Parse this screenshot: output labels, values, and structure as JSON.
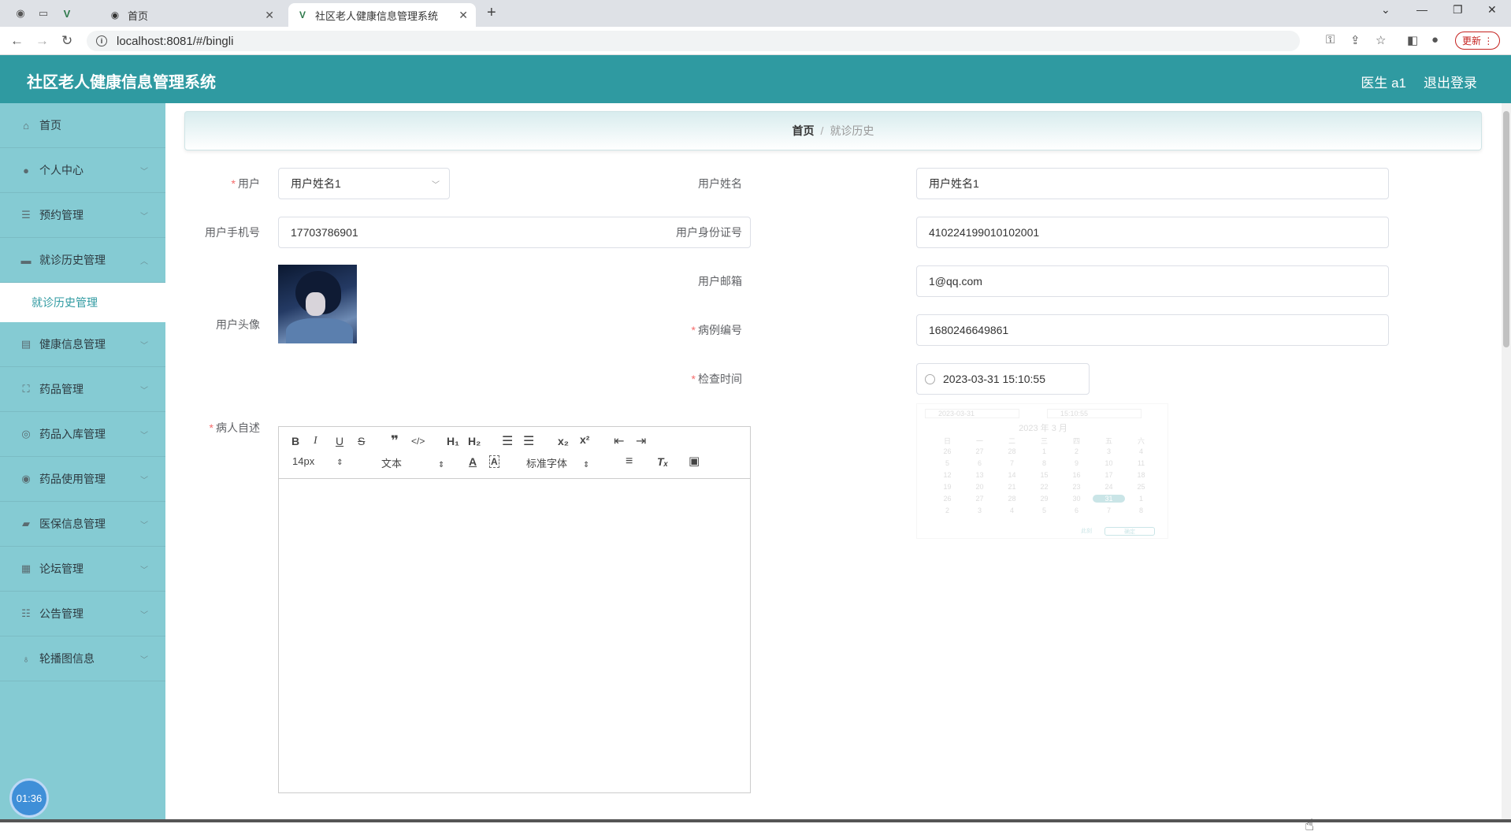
{
  "browser": {
    "tabs": [
      {
        "title": "首页",
        "active": false
      },
      {
        "title": "社区老人健康信息管理系统",
        "active": true
      }
    ],
    "url": "localhost:8081/#/bingli",
    "update_label": "更新"
  },
  "header": {
    "title": "社区老人健康信息管理系统",
    "user": "医生 a1",
    "logout": "退出登录"
  },
  "sidebar": {
    "items": [
      {
        "label": "首页",
        "icon": "home-icon"
      },
      {
        "label": "个人中心",
        "icon": "user-icon"
      },
      {
        "label": "预约管理",
        "icon": "list-icon"
      },
      {
        "label": "就诊历史管理",
        "icon": "folder-icon",
        "expanded": true
      },
      {
        "label": "健康信息管理",
        "icon": "clipboard-icon"
      },
      {
        "label": "药品管理",
        "icon": "frame-icon"
      },
      {
        "label": "药品入库管理",
        "icon": "compass-icon"
      },
      {
        "label": "药品使用管理",
        "icon": "target-icon"
      },
      {
        "label": "医保信息管理",
        "icon": "chat-icon"
      },
      {
        "label": "论坛管理",
        "icon": "grid-icon"
      },
      {
        "label": "公告管理",
        "icon": "sliders-icon"
      },
      {
        "label": "轮播图信息",
        "icon": "mic-icon"
      }
    ],
    "sub_active": "就诊历史管理",
    "timer": "01:36"
  },
  "breadcrumb": {
    "home": "首页",
    "separator": "/",
    "current": "就诊历史"
  },
  "form": {
    "user_label": "用户",
    "user_value": "用户姓名1",
    "username_label": "用户姓名",
    "username_value": "用户姓名1",
    "phone_label": "用户手机号",
    "phone_value": "17703786901",
    "idcard_label": "用户身份证号",
    "idcard_value": "410224199010102001",
    "avatar_label": "用户头像",
    "email_label": "用户邮箱",
    "email_value": "1@qq.com",
    "case_no_label": "病例编号",
    "case_no_value": "1680246649861",
    "exam_time_label": "检查时间",
    "exam_time_value": "2023-03-31 15:10:55",
    "complaint_label": "病人自述"
  },
  "editor": {
    "font_size": "14px",
    "block_type": "文本",
    "font_family": "标准字体"
  },
  "datepicker_panel": {
    "date": "2023-03-31",
    "time": "15:10:55",
    "month_title": "2023 年 3 月",
    "weekdays": [
      "日",
      "一",
      "二",
      "三",
      "四",
      "五",
      "六"
    ],
    "rows": [
      [
        "26",
        "27",
        "28",
        "1",
        "2",
        "3",
        "4"
      ],
      [
        "5",
        "6",
        "7",
        "8",
        "9",
        "10",
        "11"
      ],
      [
        "12",
        "13",
        "14",
        "15",
        "16",
        "17",
        "18"
      ],
      [
        "19",
        "20",
        "21",
        "22",
        "23",
        "24",
        "25"
      ],
      [
        "26",
        "27",
        "28",
        "29",
        "30",
        "31",
        "1"
      ],
      [
        "2",
        "3",
        "4",
        "5",
        "6",
        "7",
        "8"
      ]
    ],
    "now_label": "此刻",
    "confirm_label": "确定"
  },
  "colors": {
    "header": "#2f9aa1",
    "sidebar": "#85cbd3",
    "active_text": "#2f9aa1",
    "required": "#f56c6c"
  }
}
